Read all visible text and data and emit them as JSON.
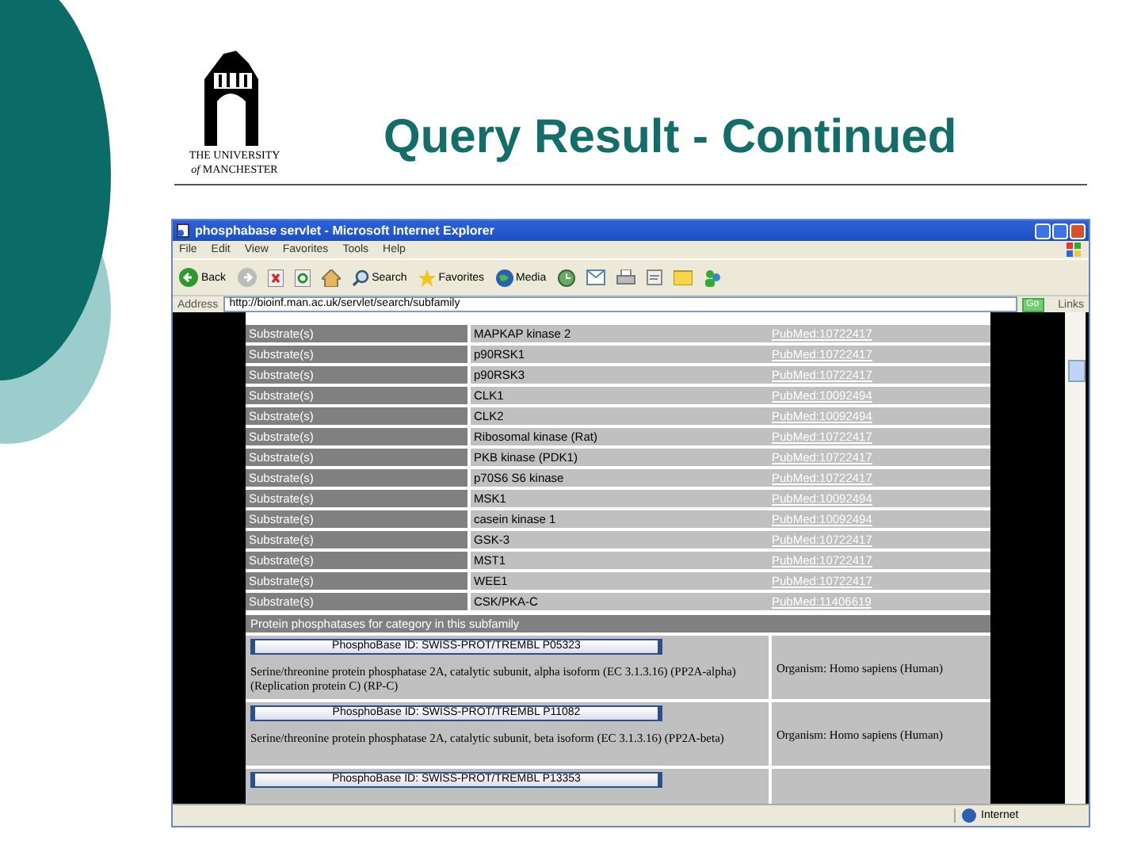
{
  "slide": {
    "logo": {
      "line1": "THE UNIVERSITY",
      "line2_of": "of",
      "line2": "MANCHESTER"
    },
    "title": "Query Result - Continued"
  },
  "browser": {
    "title": "phosphabase servlet - Microsoft Internet Explorer",
    "menu": [
      "File",
      "Edit",
      "View",
      "Favorites",
      "Tools",
      "Help"
    ],
    "toolbar": [
      {
        "kind": "back",
        "label": "Back"
      },
      {
        "kind": "forward"
      },
      {
        "kind": "stop"
      },
      {
        "kind": "refresh"
      },
      {
        "kind": "home"
      },
      {
        "kind": "search",
        "label": "Search"
      },
      {
        "kind": "favorites",
        "label": "Favorites"
      },
      {
        "kind": "media",
        "label": "Media"
      },
      {
        "kind": "history"
      },
      {
        "kind": "mail"
      },
      {
        "kind": "print"
      },
      {
        "kind": "edit"
      },
      {
        "kind": "folder"
      },
      {
        "kind": "messenger"
      }
    ],
    "address": {
      "label": "Address",
      "url": "http://bioinf.man.ac.uk/servlet/search/subfamily",
      "go": "Go",
      "links": "Links"
    },
    "table": {
      "rows": [
        {
          "role": "Substrate(s)",
          "name": "MAPKAP kinase 2",
          "ref": "PubMed:10722417"
        },
        {
          "role": "Substrate(s)",
          "name": "p90RSK1",
          "ref": "PubMed:10722417"
        },
        {
          "role": "Substrate(s)",
          "name": "p90RSK3",
          "ref": "PubMed:10722417"
        },
        {
          "role": "Substrate(s)",
          "name": "CLK1",
          "ref": "PubMed:10092494"
        },
        {
          "role": "Substrate(s)",
          "name": "CLK2",
          "ref": "PubMed:10092494"
        },
        {
          "role": "Substrate(s)",
          "name": "Ribosomal kinase (Rat)",
          "ref": "PubMed:10722417"
        },
        {
          "role": "Substrate(s)",
          "name": "PKB kinase (PDK1)",
          "ref": "PubMed:10722417"
        },
        {
          "role": "Substrate(s)",
          "name": "p70S6 S6 kinase",
          "ref": "PubMed:10722417"
        },
        {
          "role": "Substrate(s)",
          "name": "MSK1",
          "ref": "PubMed:10092494"
        },
        {
          "role": "Substrate(s)",
          "name": "casein kinase 1",
          "ref": "PubMed:10092494"
        },
        {
          "role": "Substrate(s)",
          "name": "GSK-3",
          "ref": "PubMed:10722417"
        },
        {
          "role": "Substrate(s)",
          "name": "MST1",
          "ref": "PubMed:10722417"
        },
        {
          "role": "Substrate(s)",
          "name": "WEE1",
          "ref": "PubMed:10722417"
        },
        {
          "role": "Substrate(s)",
          "name": "CSK/PKA-C",
          "ref": "PubMed:11406619"
        }
      ],
      "section_header": "Protein phosphatases for category in this subfamily",
      "records": [
        {
          "button": "PhosphoBase ID: SWISS-PROT/TREMBL P05323",
          "description": "Serine/threonine protein phosphatase 2A, catalytic subunit, alpha isoform (EC 3.1.3.16) (PP2A-alpha) (Replication protein C) (RP-C)",
          "organism": "Organism: Homo sapiens (Human)"
        },
        {
          "button": "PhosphoBase ID: SWISS-PROT/TREMBL P11082",
          "description": "Serine/threonine protein phosphatase 2A, catalytic subunit, beta isoform (EC 3.1.3.16) (PP2A-beta)",
          "organism": "Organism: Homo sapiens (Human)"
        },
        {
          "button": "PhosphoBase ID: SWISS-PROT/TREMBL P13353"
        }
      ]
    },
    "status_bar": {
      "zone": "Internet"
    }
  }
}
